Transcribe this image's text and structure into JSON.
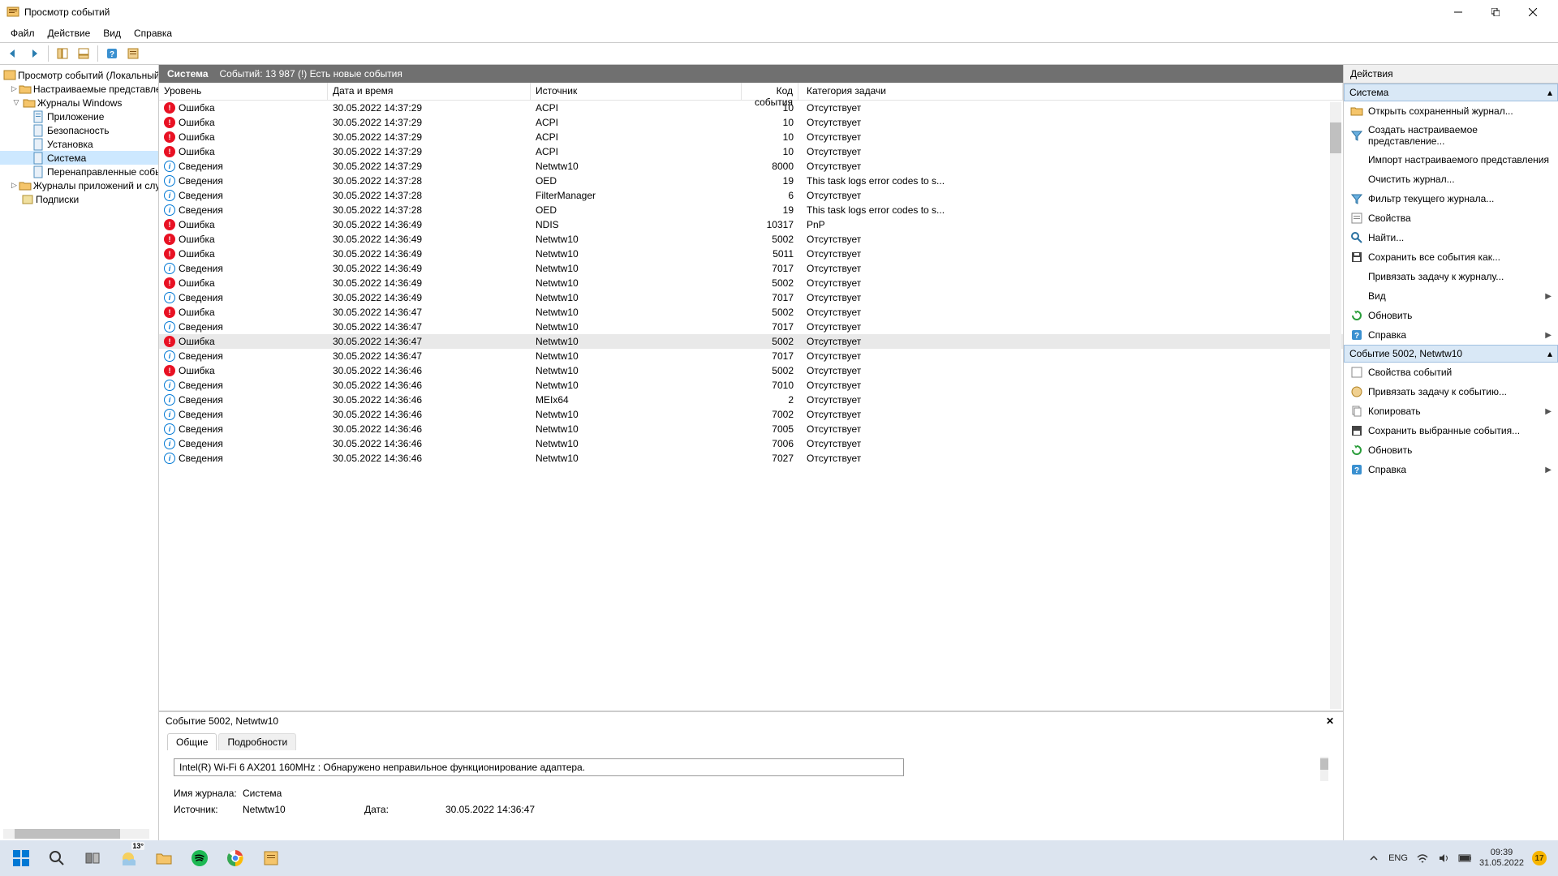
{
  "window": {
    "title": "Просмотр событий"
  },
  "menu": {
    "file": "Файл",
    "action": "Действие",
    "view": "Вид",
    "help": "Справка"
  },
  "tree": {
    "root": "Просмотр событий (Локальный)",
    "custom_views": "Настраиваемые представления",
    "win_logs": "Журналы Windows",
    "app": "Приложение",
    "security": "Безопасность",
    "setup": "Установка",
    "system": "Система",
    "forwarded": "Перенаправленные события",
    "app_svc": "Журналы приложений и служб",
    "subs": "Подписки"
  },
  "main_header": {
    "log_name": "Система",
    "info": "Событий: 13 987 (!) Есть новые события"
  },
  "columns": {
    "level": "Уровень",
    "datetime": "Дата и время",
    "source": "Источник",
    "evtid": "Код события",
    "category": "Категория задачи"
  },
  "events": [
    {
      "lvl": "Ошибка",
      "t": "err",
      "dt": "30.05.2022 14:37:29",
      "src": "ACPI",
      "id": "10",
      "cat": "Отсутствует"
    },
    {
      "lvl": "Ошибка",
      "t": "err",
      "dt": "30.05.2022 14:37:29",
      "src": "ACPI",
      "id": "10",
      "cat": "Отсутствует"
    },
    {
      "lvl": "Ошибка",
      "t": "err",
      "dt": "30.05.2022 14:37:29",
      "src": "ACPI",
      "id": "10",
      "cat": "Отсутствует"
    },
    {
      "lvl": "Ошибка",
      "t": "err",
      "dt": "30.05.2022 14:37:29",
      "src": "ACPI",
      "id": "10",
      "cat": "Отсутствует"
    },
    {
      "lvl": "Сведения",
      "t": "info",
      "dt": "30.05.2022 14:37:29",
      "src": "Netwtw10",
      "id": "8000",
      "cat": "Отсутствует"
    },
    {
      "lvl": "Сведения",
      "t": "info",
      "dt": "30.05.2022 14:37:28",
      "src": "OED",
      "id": "19",
      "cat": "This task logs error codes to s..."
    },
    {
      "lvl": "Сведения",
      "t": "info",
      "dt": "30.05.2022 14:37:28",
      "src": "FilterManager",
      "id": "6",
      "cat": "Отсутствует"
    },
    {
      "lvl": "Сведения",
      "t": "info",
      "dt": "30.05.2022 14:37:28",
      "src": "OED",
      "id": "19",
      "cat": "This task logs error codes to s..."
    },
    {
      "lvl": "Ошибка",
      "t": "err",
      "dt": "30.05.2022 14:36:49",
      "src": "NDIS",
      "id": "10317",
      "cat": "PnP"
    },
    {
      "lvl": "Ошибка",
      "t": "err",
      "dt": "30.05.2022 14:36:49",
      "src": "Netwtw10",
      "id": "5002",
      "cat": "Отсутствует"
    },
    {
      "lvl": "Ошибка",
      "t": "err",
      "dt": "30.05.2022 14:36:49",
      "src": "Netwtw10",
      "id": "5011",
      "cat": "Отсутствует"
    },
    {
      "lvl": "Сведения",
      "t": "info",
      "dt": "30.05.2022 14:36:49",
      "src": "Netwtw10",
      "id": "7017",
      "cat": "Отсутствует"
    },
    {
      "lvl": "Ошибка",
      "t": "err",
      "dt": "30.05.2022 14:36:49",
      "src": "Netwtw10",
      "id": "5002",
      "cat": "Отсутствует"
    },
    {
      "lvl": "Сведения",
      "t": "info",
      "dt": "30.05.2022 14:36:49",
      "src": "Netwtw10",
      "id": "7017",
      "cat": "Отсутствует"
    },
    {
      "lvl": "Ошибка",
      "t": "err",
      "dt": "30.05.2022 14:36:47",
      "src": "Netwtw10",
      "id": "5002",
      "cat": "Отсутствует"
    },
    {
      "lvl": "Сведения",
      "t": "info",
      "dt": "30.05.2022 14:36:47",
      "src": "Netwtw10",
      "id": "7017",
      "cat": "Отсутствует"
    },
    {
      "lvl": "Ошибка",
      "t": "err",
      "dt": "30.05.2022 14:36:47",
      "src": "Netwtw10",
      "id": "5002",
      "cat": "Отсутствует",
      "sel": true
    },
    {
      "lvl": "Сведения",
      "t": "info",
      "dt": "30.05.2022 14:36:47",
      "src": "Netwtw10",
      "id": "7017",
      "cat": "Отсутствует"
    },
    {
      "lvl": "Ошибка",
      "t": "err",
      "dt": "30.05.2022 14:36:46",
      "src": "Netwtw10",
      "id": "5002",
      "cat": "Отсутствует"
    },
    {
      "lvl": "Сведения",
      "t": "info",
      "dt": "30.05.2022 14:36:46",
      "src": "Netwtw10",
      "id": "7010",
      "cat": "Отсутствует"
    },
    {
      "lvl": "Сведения",
      "t": "info",
      "dt": "30.05.2022 14:36:46",
      "src": "MEIx64",
      "id": "2",
      "cat": "Отсутствует"
    },
    {
      "lvl": "Сведения",
      "t": "info",
      "dt": "30.05.2022 14:36:46",
      "src": "Netwtw10",
      "id": "7002",
      "cat": "Отсутствует"
    },
    {
      "lvl": "Сведения",
      "t": "info",
      "dt": "30.05.2022 14:36:46",
      "src": "Netwtw10",
      "id": "7005",
      "cat": "Отсутствует"
    },
    {
      "lvl": "Сведения",
      "t": "info",
      "dt": "30.05.2022 14:36:46",
      "src": "Netwtw10",
      "id": "7006",
      "cat": "Отсутствует"
    },
    {
      "lvl": "Сведения",
      "t": "info",
      "dt": "30.05.2022 14:36:46",
      "src": "Netwtw10",
      "id": "7027",
      "cat": "Отсутствует"
    }
  ],
  "detail": {
    "title": "Событие 5002, Netwtw10",
    "tab_general": "Общие",
    "tab_details": "Подробности",
    "description": "Intel(R) Wi-Fi 6 AX201 160MHz : Обнаружено неправильное функционирование адаптера.",
    "log_name_label": "Имя журнала:",
    "log_name_value": "Система",
    "source_label": "Источник:",
    "source_value": "Netwtw10",
    "date_label": "Дата:",
    "date_value": "30.05.2022 14:36:47"
  },
  "actions": {
    "header": "Действия",
    "section1": "Система",
    "open_saved": "Открыть сохраненный журнал...",
    "create_view": "Создать настраиваемое представление...",
    "import_view": "Импорт настраиваемого представления",
    "clear_log": "Очистить журнал...",
    "filter_log": "Фильтр текущего журнала...",
    "properties": "Свойства",
    "find": "Найти...",
    "save_all": "Сохранить все события как...",
    "attach_task": "Привязать задачу к журналу...",
    "view": "Вид",
    "refresh": "Обновить",
    "help": "Справка",
    "section2": "Событие 5002, Netwtw10",
    "event_props": "Свойства событий",
    "attach_to_event": "Привязать задачу к событию...",
    "copy": "Копировать",
    "save_selected": "Сохранить выбранные события...",
    "refresh2": "Обновить",
    "help2": "Справка"
  },
  "taskbar": {
    "weather": "13°",
    "lang": "ENG",
    "time": "09:39",
    "date": "31.05.2022",
    "notif": "17"
  }
}
